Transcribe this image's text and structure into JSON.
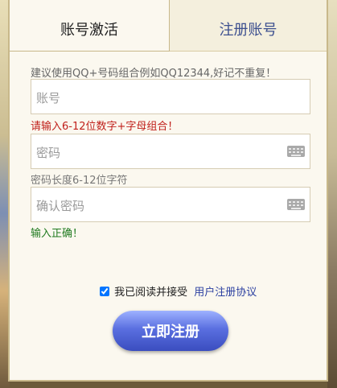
{
  "tabs": {
    "activate_label": "账号激活",
    "register_label": "注册账号"
  },
  "form": {
    "top_hint": "建议使用QQ+号码组合例如QQ12344,好记不重复！",
    "account_placeholder": "账号",
    "account_error": "请输入6-12位数字+字母组合！",
    "password_placeholder": "密码",
    "password_hint": "密码长度6-12位字符",
    "confirm_placeholder": "确认密码",
    "confirm_ok": "输入正确！",
    "agree_text": "我已阅读并接受",
    "agree_link": "用户注册协议",
    "agree_checked": true,
    "submit_label": "立即注册"
  },
  "icons": {
    "password_keyboard": "keyboard-icon",
    "confirm_keyboard": "keyboard-icon"
  },
  "colors": {
    "error": "#c0201b",
    "success": "#1f7a1f",
    "link": "#2b3fa0",
    "button": "#4a5ed6"
  }
}
